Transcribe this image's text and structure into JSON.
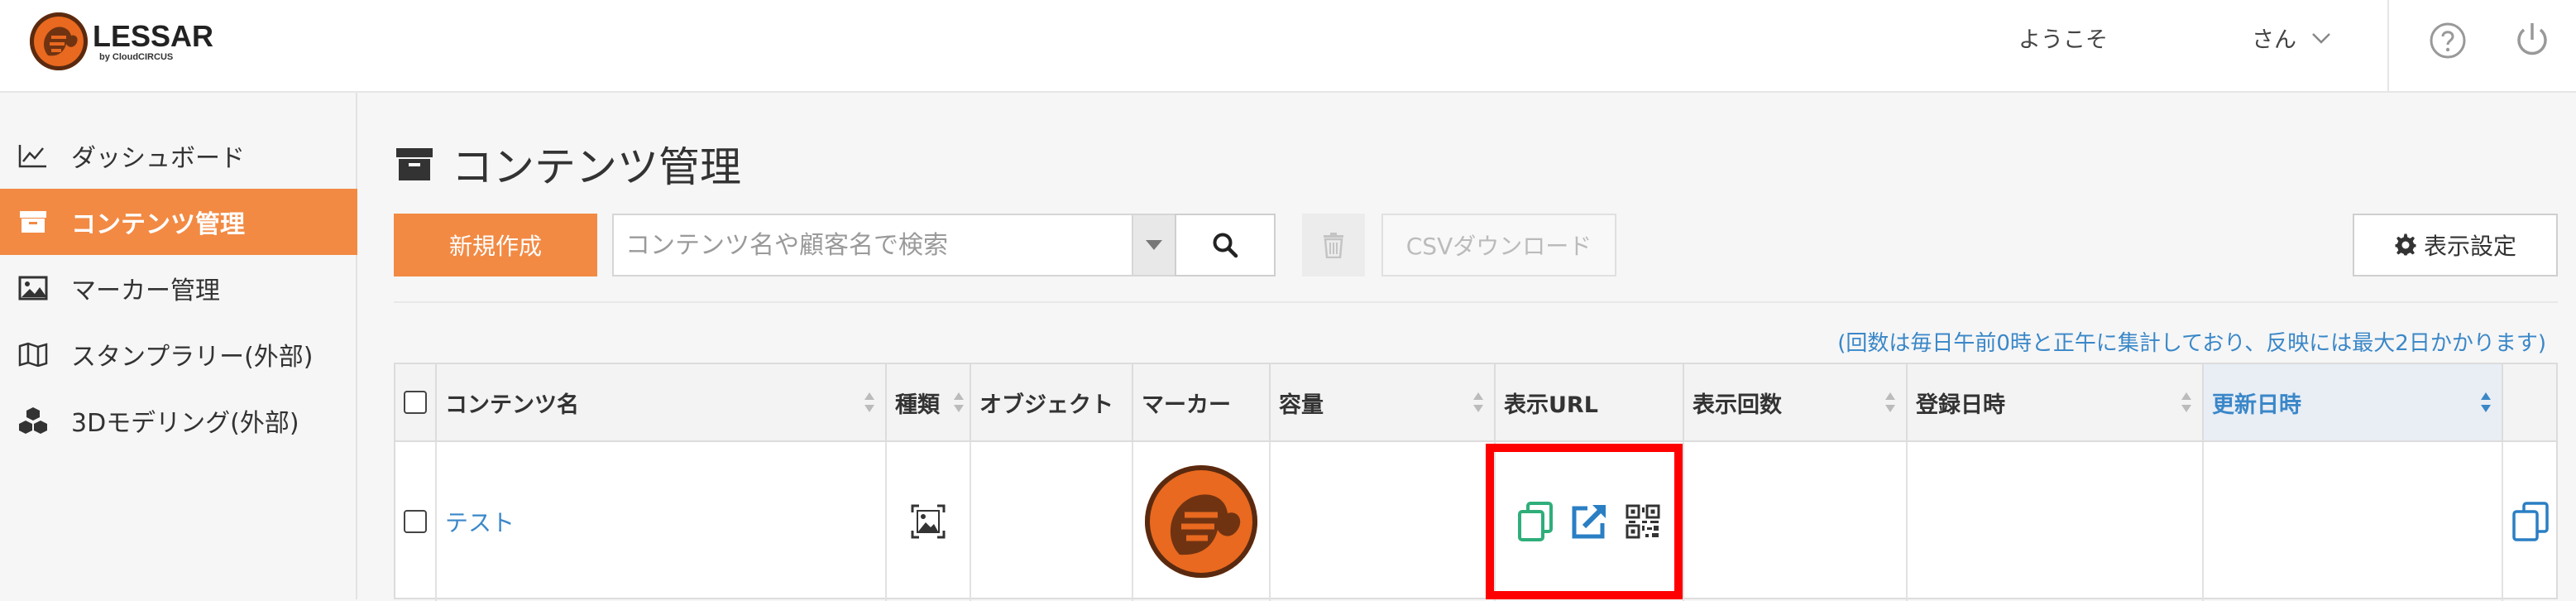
{
  "app": {
    "logo_name": "LESSAR",
    "logo_sub": "by CloudCIRCUS",
    "welcome": "ようこそ",
    "user_suffix": "さん"
  },
  "sidebar": {
    "items": [
      {
        "label": "ダッシュボード",
        "icon": "chart-line-icon",
        "active": false
      },
      {
        "label": "コンテンツ管理",
        "icon": "archive-icon",
        "active": true
      },
      {
        "label": "マーカー管理",
        "icon": "image-icon",
        "active": false
      },
      {
        "label": "スタンプラリー(外部)",
        "icon": "map-icon",
        "active": false
      },
      {
        "label": "3Dモデリング(外部)",
        "icon": "cubes-icon",
        "active": false
      }
    ]
  },
  "page": {
    "title": "コンテンツ管理"
  },
  "toolbar": {
    "new_label": "新規作成",
    "search_placeholder": "コンテンツ名や顧客名で検索",
    "csv_label": "CSVダウンロード",
    "settings_label": "表示設定"
  },
  "note": "(回数は毎日午前0時と正午に集計しており、反映には最大2日かかります)",
  "table": {
    "columns": [
      "コンテンツ名",
      "種類",
      "オブジェクト",
      "マーカー",
      "容量",
      "表示URL",
      "表示回数",
      "登録日時",
      "更新日時"
    ],
    "sorted_column": "更新日時",
    "rows": [
      {
        "name": "テスト",
        "type_icon": "image-frame-icon",
        "object": "",
        "marker": "marker-thumbnail",
        "size": "",
        "url_actions": [
          "copy-icon",
          "external-link-icon",
          "qrcode-icon"
        ],
        "views": "",
        "registered": "",
        "updated": ""
      }
    ]
  },
  "colors": {
    "accent": "#f28a44",
    "link": "#3a87c8",
    "highlight": "#ff0000"
  }
}
